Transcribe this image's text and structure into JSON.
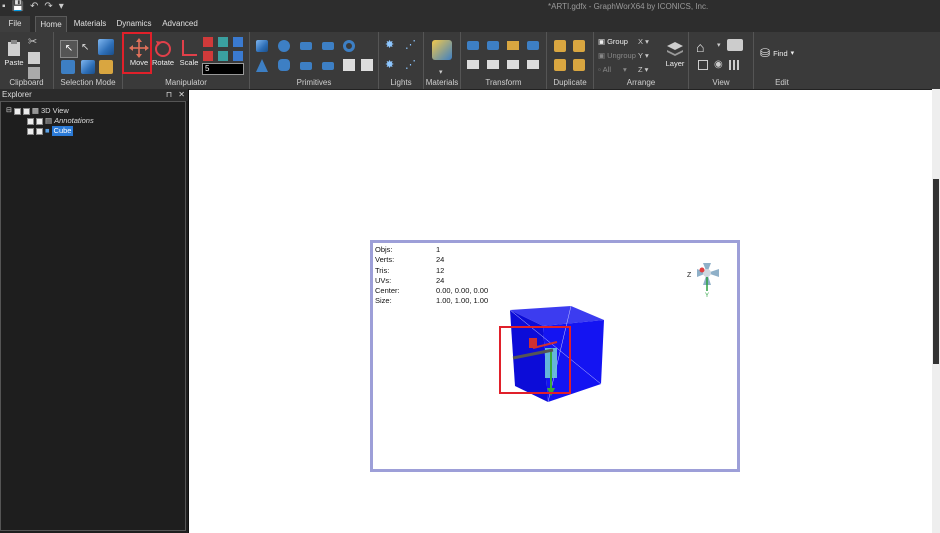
{
  "window": {
    "title": "*ARTI.gdfx - GraphWorX64 by ICONICS, Inc."
  },
  "tabs": [
    "File",
    "Home",
    "Materials",
    "Dynamics",
    "Advanced"
  ],
  "active_tab": "Home",
  "ribbon": {
    "clipboard": {
      "label": "Clipboard",
      "paste": "Paste"
    },
    "selection_mode": {
      "label": "Selection Mode"
    },
    "manipulator": {
      "label": "Manipulator",
      "move": "Move",
      "rotate": "Rotate",
      "scale": "Scale",
      "snap_value": "5"
    },
    "primitives": {
      "label": "Primitives"
    },
    "lights": {
      "label": "Lights"
    },
    "materials": {
      "label": "Materials"
    },
    "transform": {
      "label": "Transform"
    },
    "duplicate": {
      "label": "Duplicate"
    },
    "arrange": {
      "label": "Arrange",
      "group": "Group",
      "ungroup": "Ungroup",
      "all": "All",
      "x": "X",
      "y": "Y",
      "z": "Z",
      "layer": "Layer"
    },
    "view": {
      "label": "View"
    },
    "edit": {
      "label": "Edit",
      "find": "Find"
    }
  },
  "explorer": {
    "title": "Explorer",
    "items": [
      {
        "label": "3D View"
      },
      {
        "label": "Annotations"
      },
      {
        "label": "Cube"
      }
    ]
  },
  "viewport": {
    "stats": [
      {
        "key": "Objs:",
        "value": "1"
      },
      {
        "key": "Verts:",
        "value": "24"
      },
      {
        "key": "Tris:",
        "value": "12"
      },
      {
        "key": "UVs:",
        "value": "24"
      },
      {
        "key": "Center:",
        "value": "0.00, 0.00, 0.00"
      },
      {
        "key": "Size:",
        "value": "1.00, 1.00, 1.00"
      }
    ],
    "axes": {
      "z": "Z",
      "y": "Y"
    }
  },
  "colors": {
    "highlight": "#e0202a",
    "cube": "#1010e0",
    "viewport_border": "#9d9fd8"
  }
}
